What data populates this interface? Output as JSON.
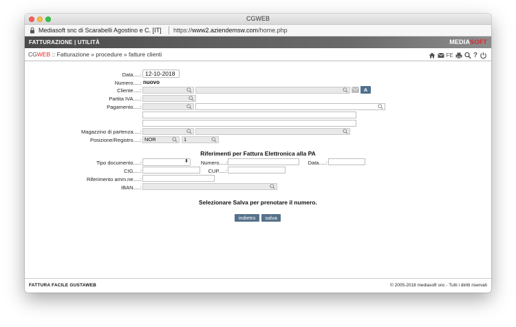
{
  "window": {
    "title": "CGWEB"
  },
  "urlbar": {
    "org": "Mediasoft snc di Scarabelli Agostino e C. [IT]",
    "address_prefix": "https://",
    "address_host": "www2.aziendemsw.com",
    "address_path": "/home.php"
  },
  "topbar": {
    "menu": "FATTURAZIONE | UTILITÀ",
    "brand_main": "MEDIA",
    "brand_accent": "SOFT"
  },
  "breadcrumb": {
    "cg": "CG",
    "web": "WEB",
    "path": " :: Fatturazione » procedure » fatture clienti"
  },
  "toolbar": {
    "fe_label": "FE",
    "help_label": "?"
  },
  "form": {
    "data_label": "Data.....:",
    "data_value": "12-10-2018",
    "numero_label": "Numero.....:",
    "numero_value": "nuovo",
    "cliente_label": "Cliente.....:",
    "cliente_button": "A",
    "piva_label": "Partita IVA.....:",
    "pagamento_label": "Pagamento.....:",
    "magazzino_label": "Magazzino di partenza.....:",
    "posizione_label": "Posizione/Registro.....:",
    "posizione_value": "NOR",
    "registro_value": "1"
  },
  "pa": {
    "title": "Riferimenti per Fattura Elettronica alla PA",
    "tipo_label": "Tipo documento.....:",
    "tipo_arrows": "⬍",
    "numero_label": "Numero.....:",
    "data_label": "Data.....:",
    "cig_label": "CIG.....:",
    "cup_label": "CUP.....:",
    "rif_label": "Riferimento amm.ne.....:",
    "iban_label": "IBAN.....:"
  },
  "message": "Selezionare Salva per prenotare il numero.",
  "buttons": {
    "back": "indietro",
    "save": "salva"
  },
  "footer": {
    "left": "FATTURA FACILE GUSTAWEB",
    "right": "© 2005-2018 mediasoft snc - Tutti i diritti riservati"
  },
  "colors": {
    "accent_red": "#e5242b",
    "button_blue": "#55708a",
    "topbar_dark": "#4a4a4a"
  }
}
